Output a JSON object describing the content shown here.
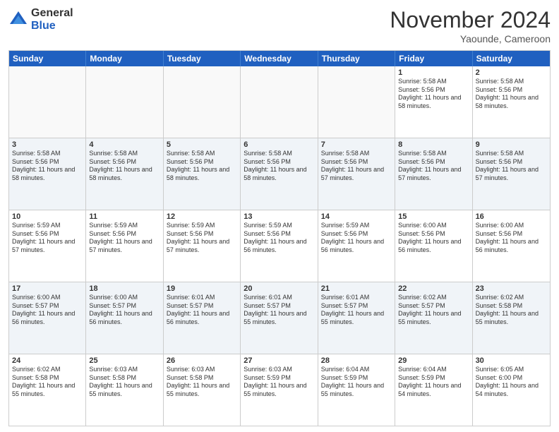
{
  "header": {
    "logo_general": "General",
    "logo_blue": "Blue",
    "month_title": "November 2024",
    "location": "Yaounde, Cameroon"
  },
  "weekdays": [
    "Sunday",
    "Monday",
    "Tuesday",
    "Wednesday",
    "Thursday",
    "Friday",
    "Saturday"
  ],
  "rows": [
    {
      "cells": [
        {
          "day": "",
          "empty": true
        },
        {
          "day": "",
          "empty": true
        },
        {
          "day": "",
          "empty": true
        },
        {
          "day": "",
          "empty": true
        },
        {
          "day": "",
          "empty": true
        },
        {
          "day": "1",
          "sunrise": "Sunrise: 5:58 AM",
          "sunset": "Sunset: 5:56 PM",
          "daylight": "Daylight: 11 hours and 58 minutes."
        },
        {
          "day": "2",
          "sunrise": "Sunrise: 5:58 AM",
          "sunset": "Sunset: 5:56 PM",
          "daylight": "Daylight: 11 hours and 58 minutes."
        }
      ]
    },
    {
      "cells": [
        {
          "day": "3",
          "sunrise": "Sunrise: 5:58 AM",
          "sunset": "Sunset: 5:56 PM",
          "daylight": "Daylight: 11 hours and 58 minutes."
        },
        {
          "day": "4",
          "sunrise": "Sunrise: 5:58 AM",
          "sunset": "Sunset: 5:56 PM",
          "daylight": "Daylight: 11 hours and 58 minutes."
        },
        {
          "day": "5",
          "sunrise": "Sunrise: 5:58 AM",
          "sunset": "Sunset: 5:56 PM",
          "daylight": "Daylight: 11 hours and 58 minutes."
        },
        {
          "day": "6",
          "sunrise": "Sunrise: 5:58 AM",
          "sunset": "Sunset: 5:56 PM",
          "daylight": "Daylight: 11 hours and 58 minutes."
        },
        {
          "day": "7",
          "sunrise": "Sunrise: 5:58 AM",
          "sunset": "Sunset: 5:56 PM",
          "daylight": "Daylight: 11 hours and 57 minutes."
        },
        {
          "day": "8",
          "sunrise": "Sunrise: 5:58 AM",
          "sunset": "Sunset: 5:56 PM",
          "daylight": "Daylight: 11 hours and 57 minutes."
        },
        {
          "day": "9",
          "sunrise": "Sunrise: 5:58 AM",
          "sunset": "Sunset: 5:56 PM",
          "daylight": "Daylight: 11 hours and 57 minutes."
        }
      ]
    },
    {
      "cells": [
        {
          "day": "10",
          "sunrise": "Sunrise: 5:59 AM",
          "sunset": "Sunset: 5:56 PM",
          "daylight": "Daylight: 11 hours and 57 minutes."
        },
        {
          "day": "11",
          "sunrise": "Sunrise: 5:59 AM",
          "sunset": "Sunset: 5:56 PM",
          "daylight": "Daylight: 11 hours and 57 minutes."
        },
        {
          "day": "12",
          "sunrise": "Sunrise: 5:59 AM",
          "sunset": "Sunset: 5:56 PM",
          "daylight": "Daylight: 11 hours and 57 minutes."
        },
        {
          "day": "13",
          "sunrise": "Sunrise: 5:59 AM",
          "sunset": "Sunset: 5:56 PM",
          "daylight": "Daylight: 11 hours and 56 minutes."
        },
        {
          "day": "14",
          "sunrise": "Sunrise: 5:59 AM",
          "sunset": "Sunset: 5:56 PM",
          "daylight": "Daylight: 11 hours and 56 minutes."
        },
        {
          "day": "15",
          "sunrise": "Sunrise: 6:00 AM",
          "sunset": "Sunset: 5:56 PM",
          "daylight": "Daylight: 11 hours and 56 minutes."
        },
        {
          "day": "16",
          "sunrise": "Sunrise: 6:00 AM",
          "sunset": "Sunset: 5:56 PM",
          "daylight": "Daylight: 11 hours and 56 minutes."
        }
      ]
    },
    {
      "cells": [
        {
          "day": "17",
          "sunrise": "Sunrise: 6:00 AM",
          "sunset": "Sunset: 5:57 PM",
          "daylight": "Daylight: 11 hours and 56 minutes."
        },
        {
          "day": "18",
          "sunrise": "Sunrise: 6:00 AM",
          "sunset": "Sunset: 5:57 PM",
          "daylight": "Daylight: 11 hours and 56 minutes."
        },
        {
          "day": "19",
          "sunrise": "Sunrise: 6:01 AM",
          "sunset": "Sunset: 5:57 PM",
          "daylight": "Daylight: 11 hours and 56 minutes."
        },
        {
          "day": "20",
          "sunrise": "Sunrise: 6:01 AM",
          "sunset": "Sunset: 5:57 PM",
          "daylight": "Daylight: 11 hours and 55 minutes."
        },
        {
          "day": "21",
          "sunrise": "Sunrise: 6:01 AM",
          "sunset": "Sunset: 5:57 PM",
          "daylight": "Daylight: 11 hours and 55 minutes."
        },
        {
          "day": "22",
          "sunrise": "Sunrise: 6:02 AM",
          "sunset": "Sunset: 5:57 PM",
          "daylight": "Daylight: 11 hours and 55 minutes."
        },
        {
          "day": "23",
          "sunrise": "Sunrise: 6:02 AM",
          "sunset": "Sunset: 5:58 PM",
          "daylight": "Daylight: 11 hours and 55 minutes."
        }
      ]
    },
    {
      "cells": [
        {
          "day": "24",
          "sunrise": "Sunrise: 6:02 AM",
          "sunset": "Sunset: 5:58 PM",
          "daylight": "Daylight: 11 hours and 55 minutes."
        },
        {
          "day": "25",
          "sunrise": "Sunrise: 6:03 AM",
          "sunset": "Sunset: 5:58 PM",
          "daylight": "Daylight: 11 hours and 55 minutes."
        },
        {
          "day": "26",
          "sunrise": "Sunrise: 6:03 AM",
          "sunset": "Sunset: 5:58 PM",
          "daylight": "Daylight: 11 hours and 55 minutes."
        },
        {
          "day": "27",
          "sunrise": "Sunrise: 6:03 AM",
          "sunset": "Sunset: 5:59 PM",
          "daylight": "Daylight: 11 hours and 55 minutes."
        },
        {
          "day": "28",
          "sunrise": "Sunrise: 6:04 AM",
          "sunset": "Sunset: 5:59 PM",
          "daylight": "Daylight: 11 hours and 55 minutes."
        },
        {
          "day": "29",
          "sunrise": "Sunrise: 6:04 AM",
          "sunset": "Sunset: 5:59 PM",
          "daylight": "Daylight: 11 hours and 54 minutes."
        },
        {
          "day": "30",
          "sunrise": "Sunrise: 6:05 AM",
          "sunset": "Sunset: 6:00 PM",
          "daylight": "Daylight: 11 hours and 54 minutes."
        }
      ]
    }
  ]
}
